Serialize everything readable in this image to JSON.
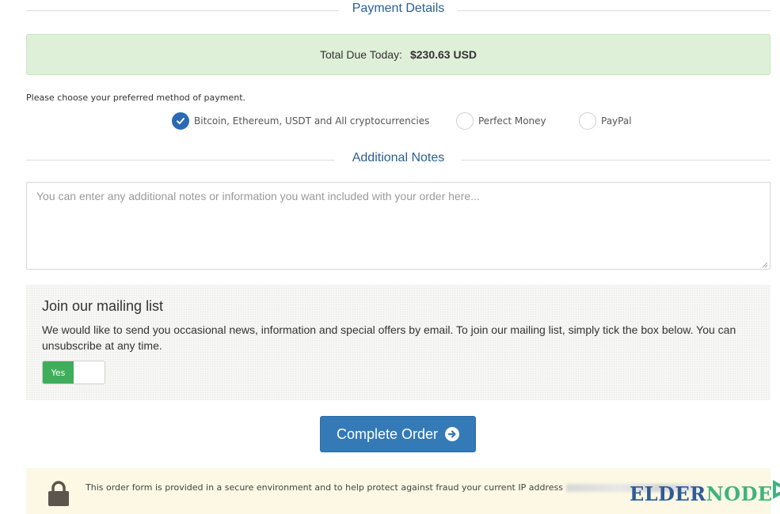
{
  "payment_section": {
    "title": "Payment Details"
  },
  "total": {
    "label": "Total Due Today:",
    "amount": "$230.63 USD"
  },
  "payment": {
    "prompt": "Please choose your preferred method of payment.",
    "options": [
      {
        "label": "Bitcoin, Ethereum, USDT and All cryptocurrencies",
        "selected": true
      },
      {
        "label": "Perfect Money",
        "selected": false
      },
      {
        "label": "PayPal",
        "selected": false
      }
    ]
  },
  "notes_section": {
    "title": "Additional Notes",
    "placeholder": "You can enter any additional notes or information you want included with your order here...",
    "value": ""
  },
  "mailing": {
    "heading": "Join our mailing list",
    "description": "We would like to send you occasional news, information and special offers by email. To join our mailing list, simply tick the box below. You can unsubscribe at any time.",
    "toggle_label": "Yes",
    "toggle_on": true
  },
  "order": {
    "button_label": "Complete Order",
    "icon": "arrow-circle-right-icon"
  },
  "secure": {
    "text": "This order form is provided in a secure environment and to help protect against fraud your current IP address",
    "icon": "lock-icon"
  },
  "logo": {
    "part1": "ELDER",
    "part2": "NODE",
    "icon": "play-triangle-icon"
  },
  "colors": {
    "accent": "#337ab7",
    "heading_blue": "#2a5f95",
    "success_bg": "#dff0d8",
    "toggle_green": "#3fae5a",
    "warning_bg": "#fcf8e3"
  }
}
